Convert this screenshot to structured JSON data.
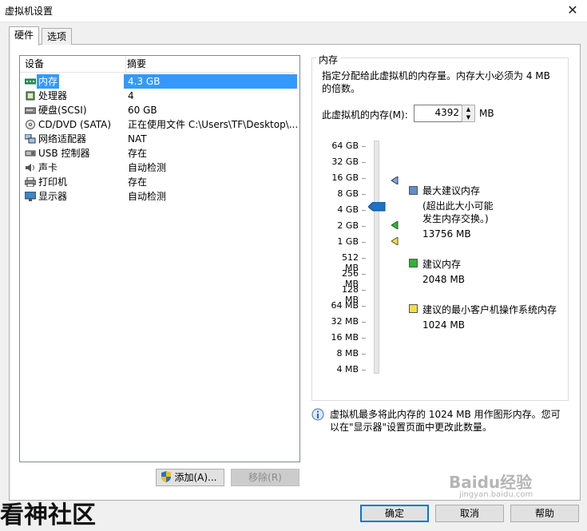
{
  "window": {
    "title": "虚拟机设置"
  },
  "tabs": [
    {
      "label": "硬件"
    },
    {
      "label": "选项"
    }
  ],
  "device_list": {
    "columns": [
      "设备",
      "摘要"
    ],
    "rows": [
      {
        "icon": "memory-icon",
        "device": "内存",
        "summary": "4.3 GB",
        "selected": true
      },
      {
        "icon": "processor-icon",
        "device": "处理器",
        "summary": "4"
      },
      {
        "icon": "harddisk-icon",
        "device": "硬盘(SCSI)",
        "summary": "60 GB"
      },
      {
        "icon": "cdrom-icon",
        "device": "CD/DVD (SATA)",
        "summary": "正在使用文件 C:\\Users\\TF\\Desktop\\..."
      },
      {
        "icon": "network-icon",
        "device": "网络适配器",
        "summary": "NAT"
      },
      {
        "icon": "usb-icon",
        "device": "USB 控制器",
        "summary": "存在"
      },
      {
        "icon": "sound-icon",
        "device": "声卡",
        "summary": "自动检测"
      },
      {
        "icon": "printer-icon",
        "device": "打印机",
        "summary": "存在"
      },
      {
        "icon": "display-icon",
        "device": "显示器",
        "summary": "自动检测"
      }
    ]
  },
  "list_buttons": {
    "add": "添加(A)...",
    "remove": "移除(R)"
  },
  "memory": {
    "group_label": "内存",
    "description": "指定分配给此虚拟机的内存量。内存大小必须为 4 MB 的倍数。",
    "memory_label": "此虚拟机的内存(M):",
    "memory_value": "4392",
    "memory_unit": "MB",
    "scale_ticks": [
      "64 GB",
      "32 GB",
      "16 GB",
      "8 GB",
      "4 GB",
      "2 GB",
      "1 GB",
      "512 MB",
      "256 MB",
      "128 MB",
      "64 MB",
      "32 MB",
      "16 MB",
      "8 MB",
      "4 MB"
    ],
    "legend": {
      "max_recommended": {
        "label": "最大建议内存",
        "note": "(超出此大小可能\n发生内存交换。)",
        "value": "13756 MB",
        "color": "#5b8fc7"
      },
      "recommended": {
        "label": "建议内存",
        "value": "2048 MB",
        "color": "#2fb52f"
      },
      "guest_min": {
        "label": "建议的最小客户机操作系统内存",
        "value": "1024 MB",
        "color": "#f0e040"
      }
    },
    "info_text": "虚拟机最多将此内存的 1024 MB 用作图形内存。您可以在\"显示器\"设置页面中更改此数量。"
  },
  "footer_buttons": {
    "ok": "确定",
    "cancel": "取消",
    "help": "帮助"
  },
  "watermarks": {
    "left": "看神社区",
    "right": "Baidu经验",
    "right_url": "jingyan.baidu.com"
  }
}
